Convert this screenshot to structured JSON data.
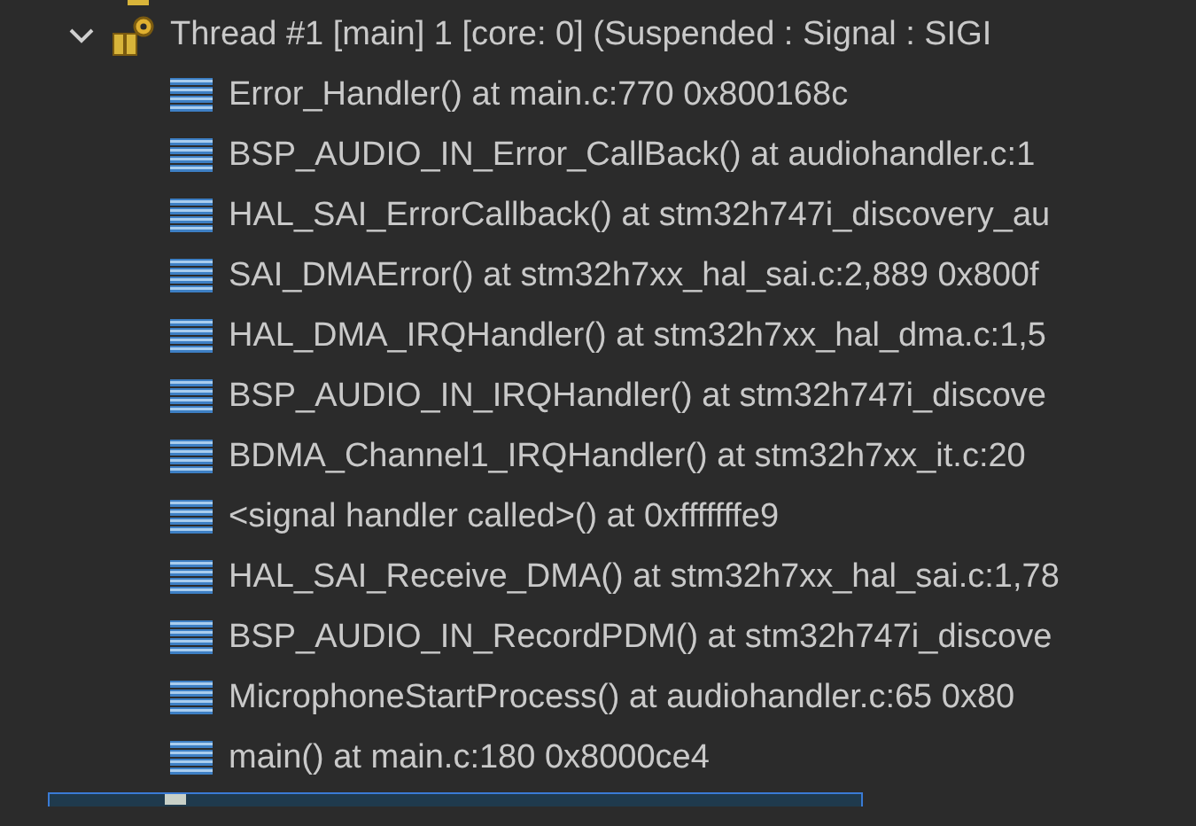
{
  "thread": {
    "label": "Thread #1 [main] 1 [core: 0] (Suspended : Signal : SIGI",
    "expanded": true
  },
  "frames": [
    {
      "label": "Error_Handler() at main.c:770 0x800168c"
    },
    {
      "label": "BSP_AUDIO_IN_Error_CallBack() at audiohandler.c:1"
    },
    {
      "label": "HAL_SAI_ErrorCallback() at stm32h747i_discovery_au"
    },
    {
      "label": "SAI_DMAError() at stm32h7xx_hal_sai.c:2,889 0x800f"
    },
    {
      "label": "HAL_DMA_IRQHandler() at stm32h7xx_hal_dma.c:1,5"
    },
    {
      "label": "BSP_AUDIO_IN_IRQHandler() at stm32h747i_discove"
    },
    {
      "label": "BDMA_Channel1_IRQHandler() at stm32h7xx_it.c:20"
    },
    {
      "label": "<signal handler called>() at 0xfffffffe9"
    },
    {
      "label": "HAL_SAI_Receive_DMA() at stm32h7xx_hal_sai.c:1,78"
    },
    {
      "label": "BSP_AUDIO_IN_RecordPDM() at stm32h747i_discove"
    },
    {
      "label": "MicrophoneStartProcess() at audiohandler.c:65 0x80"
    },
    {
      "label": "main() at main.c:180 0x8000ce4"
    }
  ],
  "next_row": {
    "selected": true
  }
}
